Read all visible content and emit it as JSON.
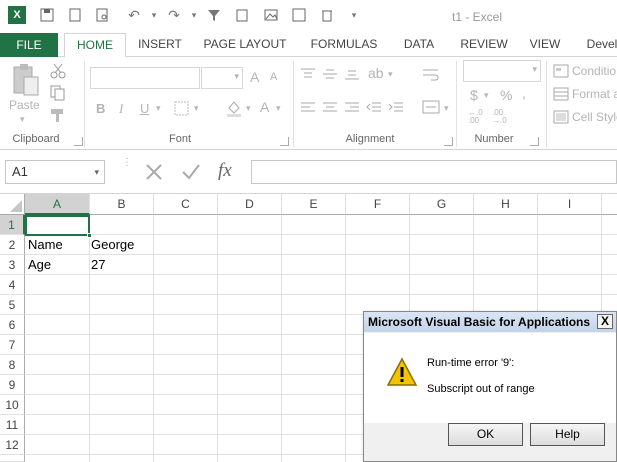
{
  "window": {
    "title": "t1 - Excel"
  },
  "tabs": [
    {
      "label": "FILE"
    },
    {
      "label": "HOME"
    },
    {
      "label": "INSERT"
    },
    {
      "label": "PAGE LAYOUT"
    },
    {
      "label": "FORMULAS"
    },
    {
      "label": "DATA"
    },
    {
      "label": "REVIEW"
    },
    {
      "label": "VIEW"
    },
    {
      "label": "Devel"
    }
  ],
  "ribbon": {
    "clipboard": {
      "paste": "Paste",
      "group": "Clipboard"
    },
    "font": {
      "bold": "B",
      "italic": "I",
      "underline": "U",
      "grow": "A",
      "shrink": "A",
      "fontcolor": "A",
      "group": "Font"
    },
    "alignment": {
      "group": "Alignment"
    },
    "number": {
      "currency": "$",
      "percent": "%",
      "group": "Number"
    },
    "styles": {
      "conditional": "Conditio",
      "format_as": "Format a",
      "cell_styles": "Cell Style"
    }
  },
  "formula_bar": {
    "name_box": "A1",
    "fx": "fx",
    "value": ""
  },
  "grid": {
    "columns": [
      "A",
      "B",
      "C",
      "D",
      "E",
      "F",
      "G",
      "H",
      "I"
    ],
    "rows": [
      "1",
      "2",
      "3",
      "4",
      "5",
      "6",
      "7",
      "8",
      "9",
      "10",
      "11",
      "12"
    ],
    "cells": [
      {
        "ref": "A2",
        "value": "Name"
      },
      {
        "ref": "B2",
        "value": "George"
      },
      {
        "ref": "A3",
        "value": "Age"
      },
      {
        "ref": "B3",
        "value": "27"
      }
    ]
  },
  "dialog": {
    "title": "Microsoft Visual Basic for Applications",
    "close": "X",
    "message1": "Run-time error '9':",
    "message2": "Subscript out of range",
    "ok": "OK",
    "help": "Help"
  },
  "colors": {
    "accent": "#217346",
    "warning": "#f5c400"
  }
}
